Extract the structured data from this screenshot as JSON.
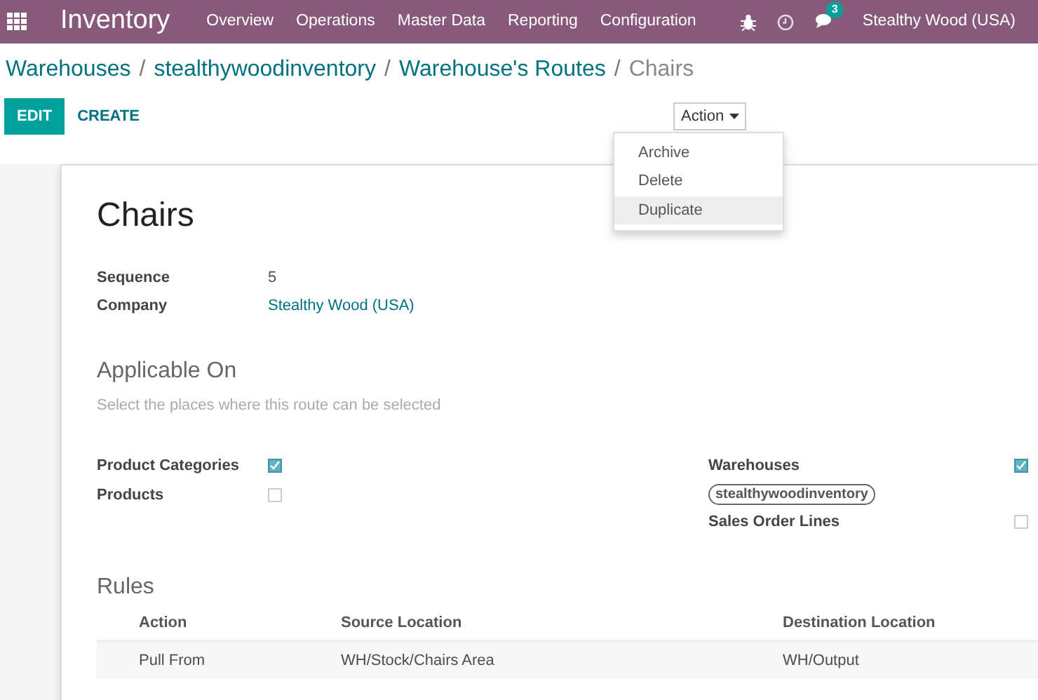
{
  "navbar": {
    "app_name": "Inventory",
    "menu": [
      "Overview",
      "Operations",
      "Master Data",
      "Reporting",
      "Configuration"
    ],
    "messages_count": "3",
    "company": "Stealthy Wood (USA)"
  },
  "breadcrumb_separators": [
    "/",
    "/",
    "/"
  ],
  "breadcrumb": [
    {
      "label": "Warehouses",
      "current": false
    },
    {
      "label": "stealthywoodinventory",
      "current": false
    },
    {
      "label": "Warehouse's Routes",
      "current": false
    },
    {
      "label": "Chairs",
      "current": true
    }
  ],
  "buttons": {
    "edit": "EDIT",
    "create": "CREATE"
  },
  "action_menu": {
    "label": "Action",
    "expanded": true,
    "items": [
      {
        "label": "Archive",
        "selected": false
      },
      {
        "label": "Delete",
        "selected": false
      },
      {
        "label": "Duplicate",
        "selected": true
      }
    ]
  },
  "record": {
    "title": "Chairs",
    "fields": [
      {
        "label": "Sequence",
        "value": "5",
        "kind": "text"
      },
      {
        "label": "Company",
        "value": "Stealthy Wood (USA)",
        "kind": "link"
      }
    ]
  },
  "applicable_on": {
    "heading": "Applicable On",
    "hint": "Select the places where this route can be selected",
    "left": [
      {
        "label": "Product Categories",
        "checked": true
      },
      {
        "label": "Products",
        "checked": false
      }
    ],
    "right": [
      {
        "label": "Warehouses",
        "checked": true,
        "tags": [
          "stealthywoodinventory"
        ]
      },
      {
        "label": "Sales Order Lines",
        "checked": false
      }
    ]
  },
  "rules": {
    "heading": "Rules",
    "columns": [
      "Action",
      "Source Location",
      "Destination Location"
    ],
    "rows": [
      [
        "Pull From",
        "WH/Stock/Chairs Area",
        "WH/Output"
      ]
    ]
  }
}
